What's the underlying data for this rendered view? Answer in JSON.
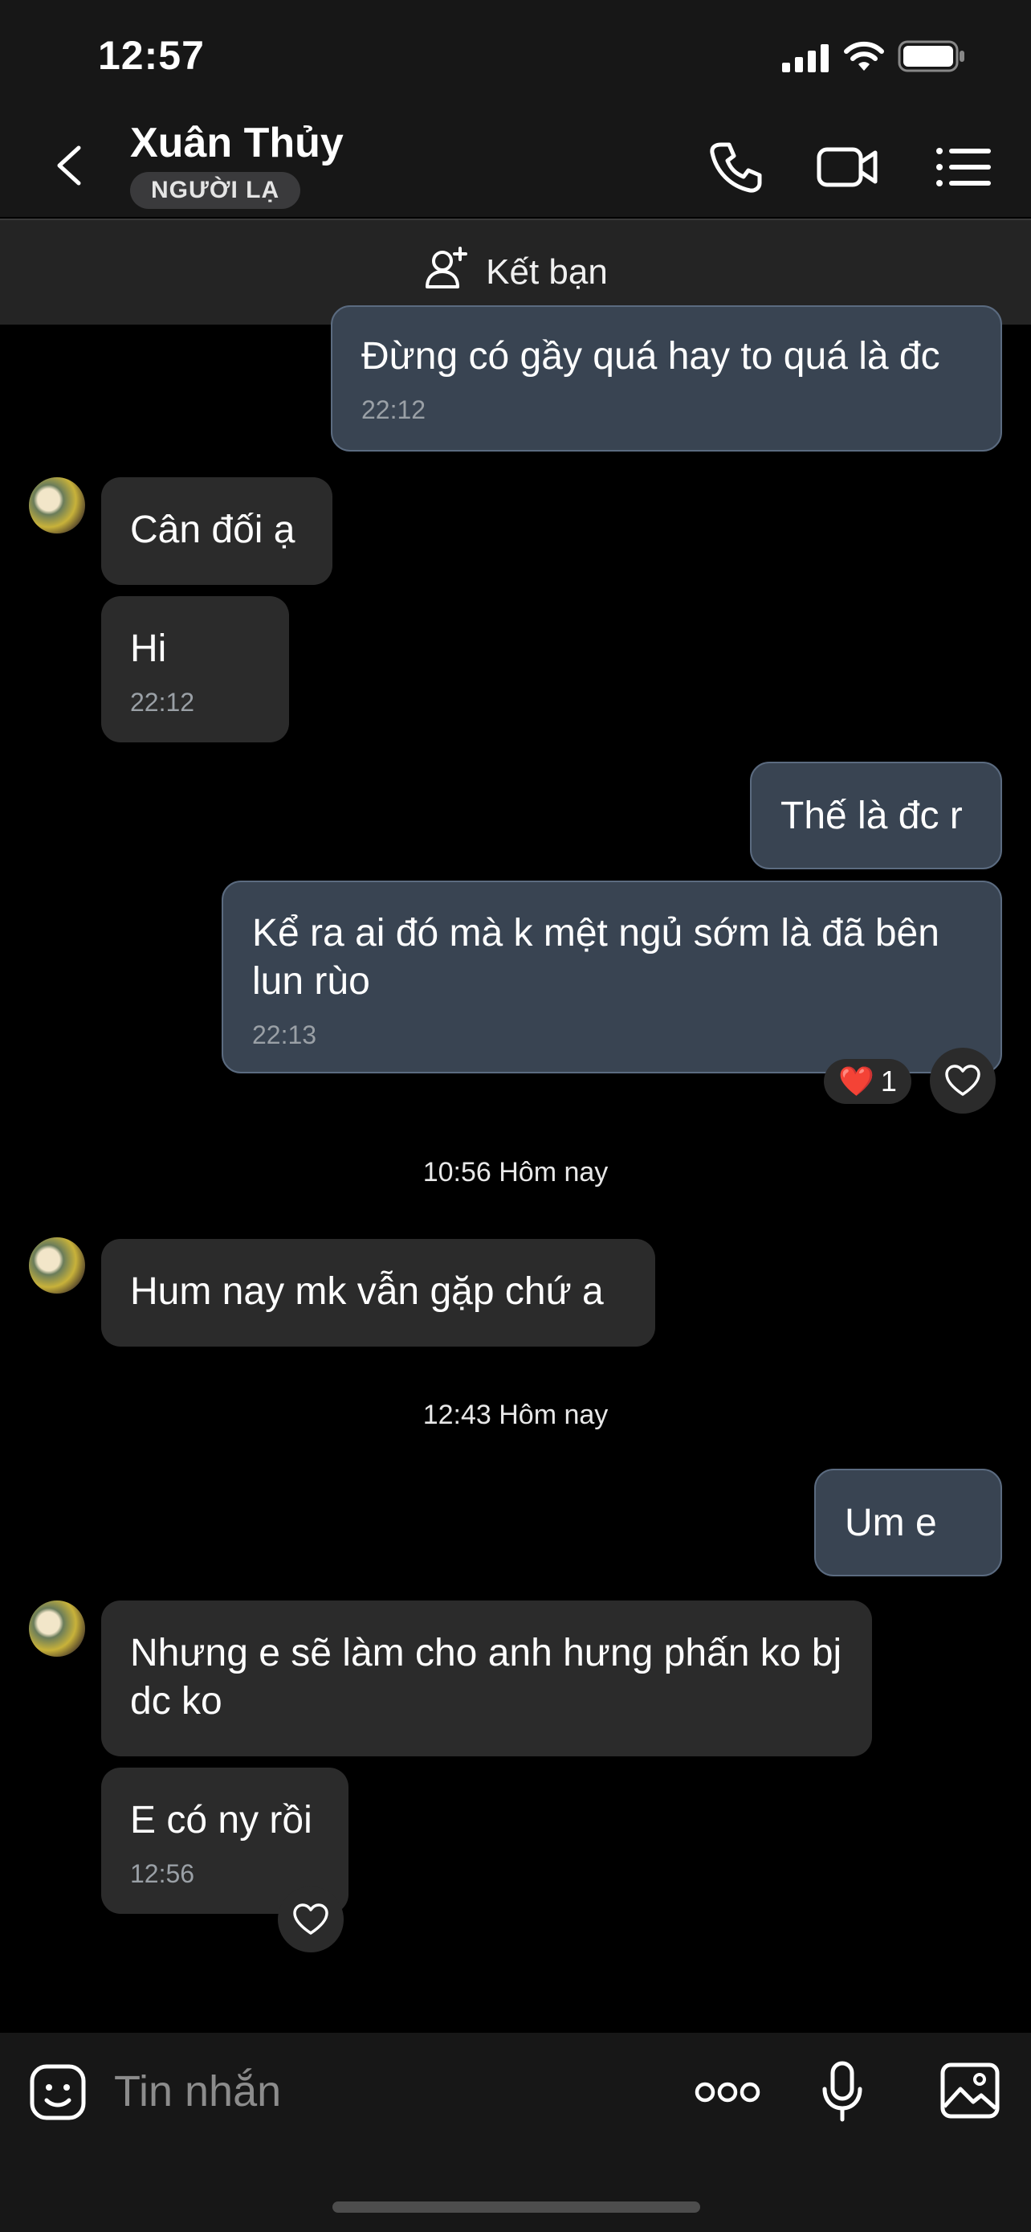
{
  "status_bar": {
    "time": "12:57"
  },
  "header": {
    "contact_name": "Xuân Thủy",
    "badge": "NGƯỜI LẠ",
    "icons": [
      "back-chevron-icon",
      "phone-icon",
      "video-camera-icon",
      "menu-list-icon"
    ]
  },
  "add_friend": {
    "label": "Kết bạn"
  },
  "messages": [
    {
      "dir": "out",
      "text": "Đừng có gầy quá hay to quá là đc",
      "time": "22:12"
    },
    {
      "dir": "in",
      "text": "Cân đối ạ"
    },
    {
      "dir": "in",
      "text": "Hi",
      "time": "22:12"
    },
    {
      "dir": "out",
      "text": "Thế là đc r"
    },
    {
      "dir": "out",
      "text": "Kể ra ai đó mà k mệt ngủ sớm là đã bên lun rùo",
      "time": "22:13",
      "reaction": {
        "emoji": "❤️",
        "count": "1"
      }
    },
    {
      "dir": "divider",
      "text": "10:56 Hôm nay"
    },
    {
      "dir": "in",
      "text": "Hum nay mk vẫn gặp chứ a"
    },
    {
      "dir": "divider",
      "text": "12:43 Hôm nay"
    },
    {
      "dir": "out",
      "text": "Um e"
    },
    {
      "dir": "in",
      "text": "Nhưng e sẽ làm cho anh hưng phấn ko bj dc ko"
    },
    {
      "dir": "in",
      "text": "E có ny rồi",
      "time": "12:56"
    }
  ],
  "composer": {
    "placeholder": "Tin nhắn",
    "icons": [
      "sticker-icon",
      "more-options-icon",
      "microphone-icon",
      "image-icon"
    ]
  },
  "colors": {
    "incoming_bubble": "#2b2b2b",
    "outgoing_bubble": "#394452",
    "background": "#000000",
    "bar": "#171717"
  }
}
